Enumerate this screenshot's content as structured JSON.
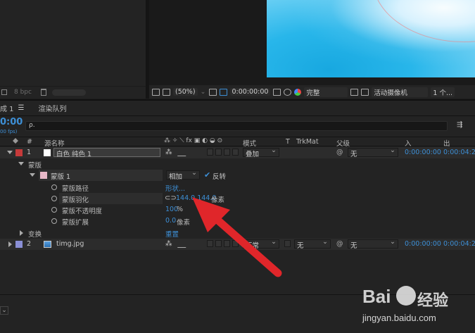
{
  "project_panel": {
    "bpc": "8 bpc"
  },
  "viewer_toolbar": {
    "zoom": "(50%)",
    "timecode": "0:00:00:00",
    "resolution": "完整",
    "camera": "活动摄像机",
    "views": "1 个..."
  },
  "tabs": [
    "成 1",
    "渲染队列"
  ],
  "timeline": {
    "current_time": "0:00",
    "fps": "00 fps)",
    "search_placeholder": "ρ."
  },
  "columns": {
    "hash": "#",
    "source_name": "源名称",
    "mode": "模式",
    "t": "T",
    "trkmat": "TrkMat",
    "parent": "父级",
    "in": "入",
    "out": "出"
  },
  "layers": [
    {
      "index": "1",
      "name": "白色 纯色 1",
      "mode": "叠加",
      "parent": "无",
      "in": "0:00:00:00",
      "out": "0:00:04:29",
      "label_color": "#c63a3a"
    },
    {
      "index": "2",
      "name": "timg.jpg",
      "mode": "正常",
      "trkmat": "无",
      "parent": "无",
      "in": "0:00:00:00",
      "out": "0:00:04:29",
      "label_color": "#8a8fd6"
    }
  ],
  "mask_group": {
    "label": "蒙版",
    "mask_name": "蒙版 1",
    "mask_mode": "相加",
    "inverted_label": "反转",
    "props": [
      {
        "name": "蒙版路径",
        "value": "形状...",
        "unit": ""
      },
      {
        "name": "蒙版羽化",
        "value": "144.0,144.0",
        "unit": "像素"
      },
      {
        "name": "蒙版不透明度",
        "value": "100",
        "unit": "%"
      },
      {
        "name": "蒙版扩展",
        "value": "0.0",
        "unit": "像素"
      }
    ]
  },
  "transform": {
    "label": "变换",
    "reset": "重置"
  },
  "watermark": {
    "brand": "Bai",
    "brand2": "经验",
    "url": "jingyan.baidu.com"
  },
  "colors": {
    "accent_blue": "#3d8fd6",
    "arrow_red": "#e0262a"
  }
}
